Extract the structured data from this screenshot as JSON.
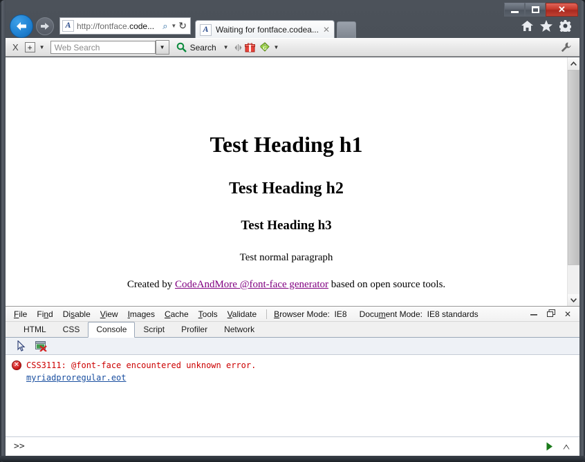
{
  "window": {
    "controls": {
      "minimize": "minimize-icon",
      "restore": "restore-icon",
      "close": "✕"
    }
  },
  "navigation": {
    "back": "back-arrow-icon",
    "forward": "forward-arrow-icon",
    "address": {
      "favicon_letter": "A",
      "url_prefix": "http://fontface.",
      "url_bold": "code...",
      "search_icon": "⌕",
      "caret": "▼",
      "refresh_icon": "↻"
    },
    "tab": {
      "favicon_letter": "A",
      "title": "Waiting for fontface.codea...",
      "close": "✕"
    },
    "toolbar_icons": [
      "home-icon",
      "favorites-star-icon",
      "tools-gear-icon"
    ]
  },
  "search_toolbar": {
    "close_label": "X",
    "add_label": "+",
    "caret": "▼",
    "placeholder": "Web Search",
    "value": "",
    "dropdown_caret": "▼",
    "magnifier": "search-icon",
    "search_label": "Search",
    "search_caret": "▼",
    "separator": "◄►",
    "gift_icon": "gift-icon",
    "tag_icon": "tag-icon",
    "tag_caret": "▼",
    "wrench_icon": "wrench-icon"
  },
  "page": {
    "h1": "Test Heading h1",
    "h2": "Test Heading h2",
    "h3": "Test Heading h3",
    "paragraph": "Test normal paragraph",
    "credit_before": "Created by ",
    "credit_link": "CodeAndMore @font-face generator",
    "credit_after": " based on open source tools.",
    "link_color": "#800080"
  },
  "scrollbar": {
    "up_arrow": "▲",
    "down_arrow": "▼"
  },
  "devtools": {
    "menus": [
      {
        "label": "File",
        "accel": "F",
        "rest": "ile"
      },
      {
        "label": "Find",
        "accel": "n",
        "pre": "Fi",
        "rest": "d"
      },
      {
        "label": "Disable",
        "accel": "s",
        "pre": "Di",
        "rest": "able"
      },
      {
        "label": "View",
        "accel": "V",
        "rest": "iew"
      },
      {
        "label": "Images",
        "accel": "I",
        "rest": "mages"
      },
      {
        "label": "Cache",
        "accel": "C",
        "rest": "ache"
      },
      {
        "label": "Tools",
        "accel": "T",
        "rest": "ools"
      },
      {
        "label": "Validate",
        "accel": "V",
        "rest": "alidate"
      }
    ],
    "browser_mode_label": "Browser Mode:",
    "browser_mode_value": "IE8",
    "document_mode_label": "Document Mode:",
    "document_mode_value": "IE8 standards",
    "window_controls": {
      "minimize": "minimize-icon",
      "restore": "restore-icon",
      "close": "✕"
    },
    "tabs": [
      {
        "label": "HTML",
        "active": false
      },
      {
        "label": "CSS",
        "active": false
      },
      {
        "label": "Console",
        "active": true
      },
      {
        "label": "Script",
        "active": false
      },
      {
        "label": "Profiler",
        "active": false
      },
      {
        "label": "Network",
        "active": false
      }
    ],
    "tools": [
      "select-element-icon",
      "clear-console-icon"
    ],
    "console": {
      "entries": [
        {
          "icon": "error-icon",
          "message": "CSS3111: @font-face encountered unknown error.",
          "link": "myriadproregular.eot",
          "message_color": "#cc0000",
          "link_color": "#1a4fa0"
        }
      ]
    },
    "input": {
      "prompt": ">>",
      "value": "",
      "placeholder": "",
      "run_icon": "run-arrow-icon",
      "expand_icon": "expand-chevron-icon"
    }
  }
}
